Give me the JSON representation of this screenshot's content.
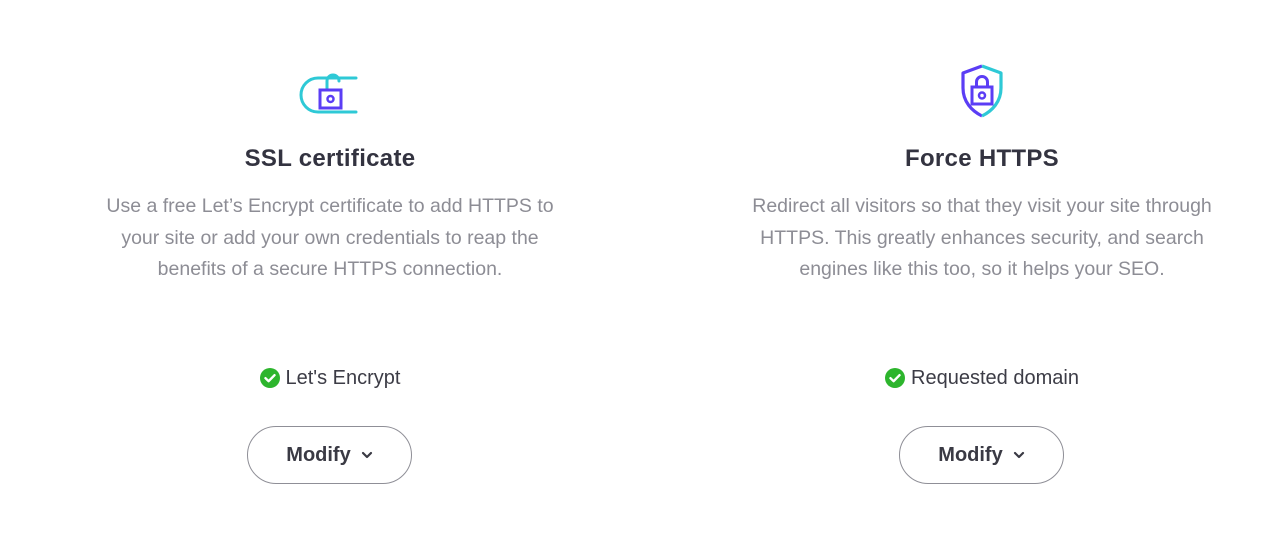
{
  "cards": [
    {
      "icon": "unlocked-padlock-icon",
      "title": "SSL certificate",
      "description": "Use a free Let’s Encrypt certificate to add HTTPS to your site or add your own credentials to reap the benefits of a secure HTTPS connection.",
      "status_icon": "check-circle-icon",
      "status_text": "Let's Encrypt",
      "button_label": "Modify",
      "button_icon": "chevron-down-icon"
    },
    {
      "icon": "shield-lock-icon",
      "title": "Force HTTPS",
      "description": "Redirect all visitors so that they visit your site through HTTPS. This greatly enhances security, and search engines like this too, so it helps your SEO.",
      "status_icon": "check-circle-icon",
      "status_text": "Requested domain",
      "button_label": "Modify",
      "button_icon": "chevron-down-icon"
    }
  ],
  "colors": {
    "accent_teal": "#2ec9d6",
    "accent_purple": "#5b3df5",
    "success_green": "#2db52d",
    "text_dark": "#333340",
    "text_muted": "#8d8d95"
  }
}
